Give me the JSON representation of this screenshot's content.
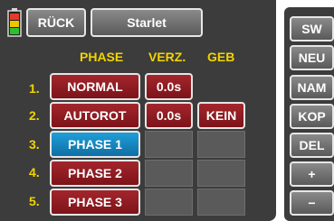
{
  "header": {
    "back_label": "RÜCK",
    "model_name": "Starlet"
  },
  "table": {
    "col_phase": "PHASE",
    "col_delay": "VERZ.",
    "col_switch": "GEB",
    "rows": [
      {
        "num": "1.",
        "phase": "NORMAL",
        "delay": "0.0s",
        "switch": ""
      },
      {
        "num": "2.",
        "phase": "AUTOROT",
        "delay": "0.0s",
        "switch": "KEIN"
      },
      {
        "num": "3.",
        "phase": "PHASE 1",
        "delay": "",
        "switch": ""
      },
      {
        "num": "4.",
        "phase": "PHASE 2",
        "delay": "",
        "switch": ""
      },
      {
        "num": "5.",
        "phase": "PHASE 3",
        "delay": "",
        "switch": ""
      }
    ]
  },
  "sidebar": {
    "buttons": [
      "SW",
      "NEU",
      "NAM",
      "KOP",
      "DEL",
      "+",
      "−"
    ]
  },
  "colors": {
    "header_text": "#f2d400",
    "selected_phase": "#1f9ed8",
    "phase_button": "#a3262c",
    "background_panel": "#3c3c3c"
  },
  "icons": {
    "battery": "battery-icon"
  }
}
